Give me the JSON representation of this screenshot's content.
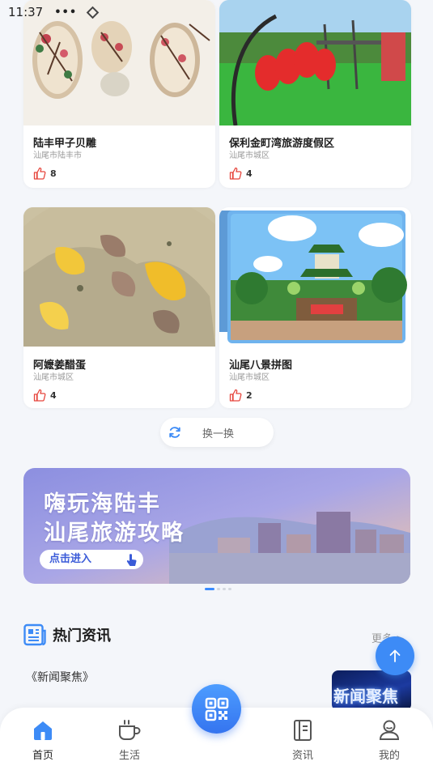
{
  "status_bar": {
    "time": "11:37",
    "dots": "•••"
  },
  "cards": [
    {
      "title": "陆丰甲子贝雕",
      "location": "汕尾市陆丰市",
      "likes": "8"
    },
    {
      "title": "保利金町湾旅游度假区",
      "location": "汕尾市城区",
      "likes": "4"
    },
    {
      "title": "阿嬷姜醋蛋",
      "location": "汕尾市城区",
      "likes": "4"
    },
    {
      "title": "汕尾八景拼图",
      "location": "汕尾市城区",
      "likes": "2"
    }
  ],
  "refresh": {
    "label": "换一换"
  },
  "banner": {
    "line1": "嗨玩海陆丰",
    "line2": "汕尾旅游攻略",
    "cta": "点击进入"
  },
  "news": {
    "section_title": "热门资讯",
    "more": "更多 >",
    "first_item": "《新闻聚焦》",
    "thumb_text": "新闻聚焦"
  },
  "tabs": [
    {
      "label": "首页",
      "icon": "home-icon"
    },
    {
      "label": "生活",
      "icon": "coffee-cup-icon"
    },
    {
      "label": "资讯",
      "icon": "news-book-icon"
    },
    {
      "label": "我的",
      "icon": "user-icon"
    }
  ],
  "colors": {
    "accent": "#3d8bf6",
    "like": "#e6453c",
    "background": "#f4f6fa"
  }
}
